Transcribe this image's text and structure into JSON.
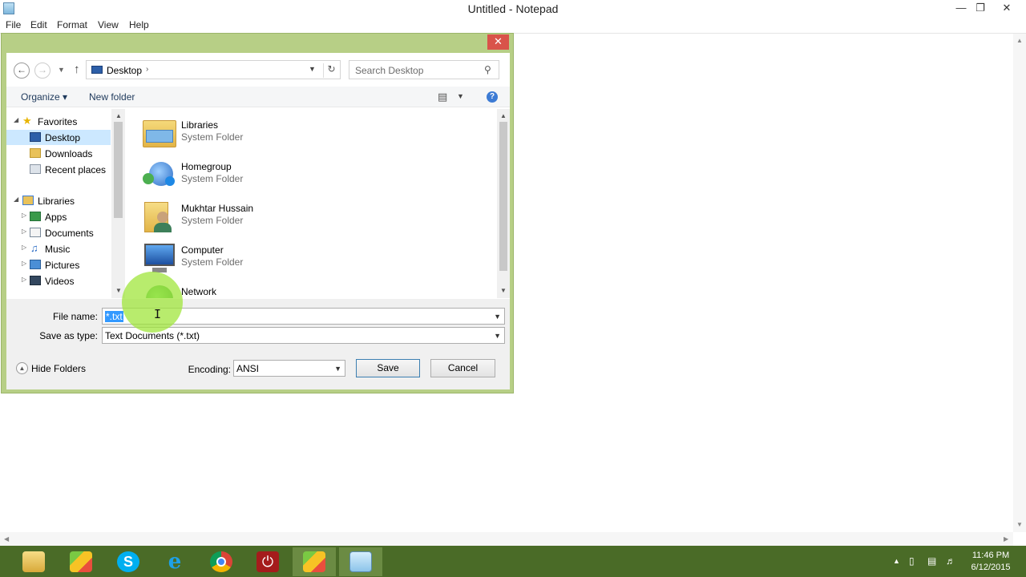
{
  "window": {
    "title": "Untitled - Notepad",
    "controls": {
      "minimize": "—",
      "maximize": "❐",
      "close": "✕"
    }
  },
  "menubar": [
    "File",
    "Edit",
    "Format",
    "View",
    "Help"
  ],
  "dialog": {
    "close_glyph": "✕",
    "address": {
      "location": "Desktop",
      "separator": "›"
    },
    "search": {
      "placeholder": "Search Desktop"
    },
    "toolbar": {
      "organize": "Organize ▾",
      "new_folder": "New folder",
      "help": "?"
    },
    "nav": {
      "favorites": {
        "label": "Favorites",
        "items": [
          "Desktop",
          "Downloads",
          "Recent places"
        ]
      },
      "libraries": {
        "label": "Libraries",
        "items": [
          "Apps",
          "Documents",
          "Music",
          "Pictures",
          "Videos"
        ]
      }
    },
    "files": [
      {
        "name": "Libraries",
        "type": "System Folder"
      },
      {
        "name": "Homegroup",
        "type": "System Folder"
      },
      {
        "name": "Mukhtar Hussain",
        "type": "System Folder"
      },
      {
        "name": "Computer",
        "type": "System Folder"
      },
      {
        "name": "Network",
        "type": ""
      }
    ],
    "form": {
      "file_name_label": "File name:",
      "file_name_value": "*.txt",
      "save_as_type_label": "Save as type:",
      "save_as_type_value": "Text Documents (*.txt)",
      "encoding_label": "Encoding:",
      "encoding_value": "ANSI",
      "save_button": "Save",
      "cancel_button": "Cancel",
      "hide_folders": "Hide Folders"
    }
  },
  "taskbar": {
    "apps": [
      "file-explorer",
      "bluestacks",
      "skype",
      "internet-explorer",
      "chrome",
      "power-tool",
      "bluestacks-2",
      "notepad"
    ],
    "clock": {
      "time": "11:46 PM",
      "date": "6/12/2015"
    }
  }
}
